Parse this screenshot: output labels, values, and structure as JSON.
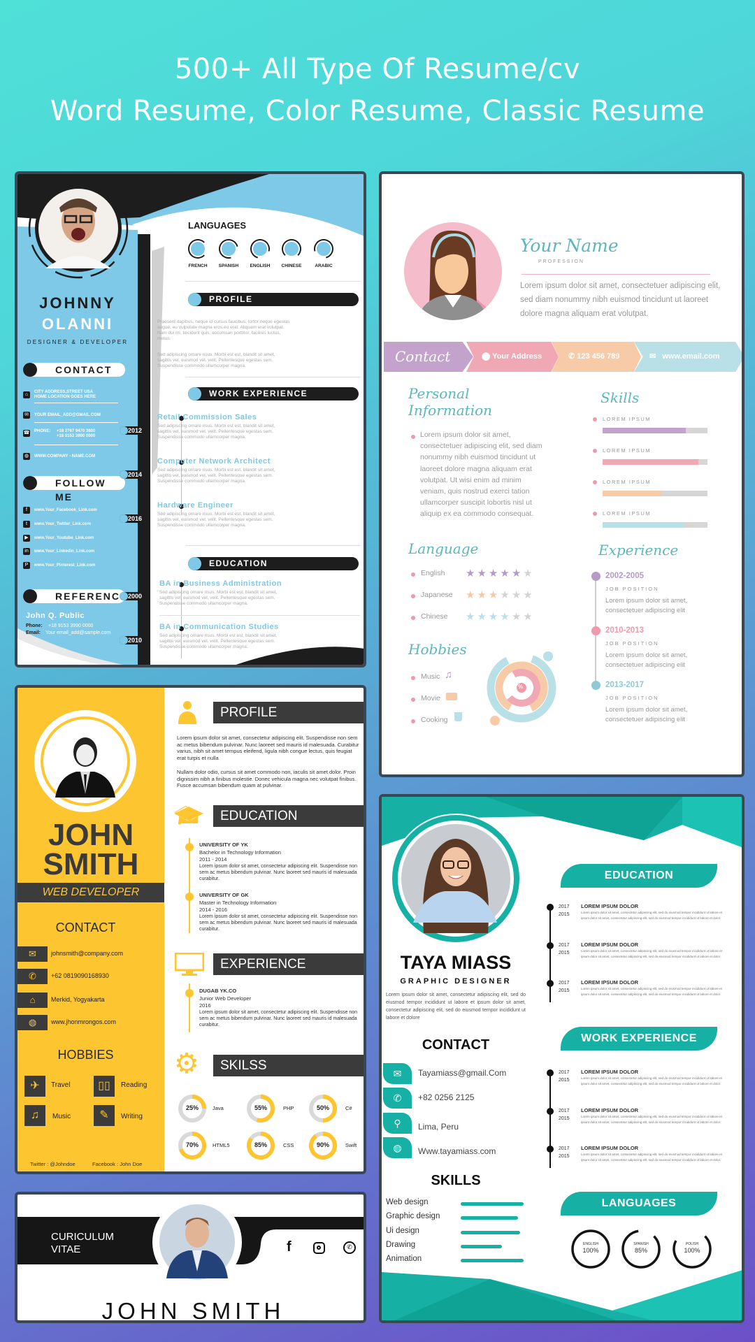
{
  "header": {
    "line1": "500+ All Type Of Resume/cv",
    "line2": "Word Resume, Color Resume, Classic Resume"
  },
  "colors": {
    "blue_template": "#7ec8e8",
    "yellow_template": "#fdc530",
    "teal_template": "#16b0a4",
    "pastel_purple": "#c3a3cc",
    "pastel_pink": "#f0a8b4",
    "pastel_peach": "#f8cba8",
    "pastel_blue": "#b8e0e6",
    "dark": "#1d1d1d"
  },
  "resume_blue": {
    "first_name": "JOHNNY",
    "last_name": "OLANNI",
    "title": "DESIGNER & DEVELOPER",
    "contact_heading": "CONTACT",
    "contact": [
      {
        "icon": "home-icon",
        "lines": [
          "CITY ADDRESS,STREET USA",
          "HOME LOCATION GOES HERE"
        ]
      },
      {
        "icon": "email-icon",
        "lines": [
          "YOUR EMAIL_ADD@GMAIL.COM"
        ]
      },
      {
        "icon": "phone-icon",
        "label": "PHONE:",
        "lines": [
          "+18 2767 9470 3800",
          "+18 9153 3990 0000"
        ]
      },
      {
        "icon": "globe-icon",
        "lines": [
          "WWW.COMPANY - NAME.COM"
        ]
      }
    ],
    "follow_heading": "FOLLOW ME",
    "social": [
      {
        "icon": "facebook-icon",
        "text": "www.Your_Facebook_Link.com"
      },
      {
        "icon": "twitter-icon",
        "text": "www.Your_Twitter_Link.com"
      },
      {
        "icon": "youtube-icon",
        "text": "www.Your_Youtube_Link.com"
      },
      {
        "icon": "linkedin-icon",
        "text": "www.Your_Linkedin_Link.com"
      },
      {
        "icon": "pinterest-icon",
        "text": "www.Your_Pinterest_Link.com"
      }
    ],
    "reference_heading": "REFERENCE",
    "reference": {
      "name": "John Q. Public",
      "phone_label": "Phone:",
      "phone": "+18 9153 3990 0000",
      "email_label": "Email:",
      "email": "Your email_add@sample.com"
    },
    "languages_heading": "LANGUAGES",
    "languages": [
      "FRENCH",
      "SPANISH",
      "ENGLISH",
      "CHINESE",
      "ARABIC"
    ],
    "profile_heading": "PROFILE",
    "profile": [
      "Praesent dapibus, neque id cursus faucibus, tortor neque egestas augue, eu vulputate magna eros eu erat. Aliquam erat volutpat. Nam dui mi, tincidunt quis, accumsan porttitor, facilisis luctus, metus.",
      "Sed adipiscing ornare risus. Morbi est est, blandit sit amet, sagittis vel, euismod vel, velit. Pellentesque egestas sem. Suspendisse commodo ullamcorper magna."
    ],
    "work_heading": "WORK EXPERIENCE",
    "work": [
      {
        "year": "2012",
        "title": "Retail Commission Sales",
        "desc": "Sed adipiscing ornare risus. Morbi est est, blandit sit amet, sagittis vel, euismod vel, velit. Pellentesque egestas sem. Suspendisse commodo ullamcorper magna."
      },
      {
        "year": "2014",
        "title": "Computer Network Architect",
        "desc": "Sed adipiscing ornare risus. Morbi est est, blandit sit amet, sagittis vel, euismod vel, velit. Pellentesque egestas sem. Suspendisse commodo ullamcorper magna."
      },
      {
        "year": "2016",
        "title": "Hardware Engineer",
        "desc": "Sed adipiscing ornare risus. Morbi est est, blandit sit amet, sagittis vel, euismod vel, velit. Pellentesque egestas sem. Suspendisse commodo ullamcorper magna."
      }
    ],
    "education_heading": "EDUCATION",
    "education": [
      {
        "year": "2000",
        "title": "BA in Business Administration",
        "desc": "Sed adipiscing ornare risus. Morbi est est, blandit sit amet, sagittis vel, euismod vel, velit. Pellentesque egestas sem. Suspendisse commodo ullamcorper magna."
      },
      {
        "year": "2010",
        "title": "BA in Communication Studies",
        "desc": "Sed adipiscing ornare risus. Morbi est est, blandit sit amet, sagittis vel, euismod vel, velit. Pellentesque egestas sem. Suspendisse commodo ullamcorper magna."
      }
    ]
  },
  "resume_pastel": {
    "name": "Your Name",
    "profession": "PROFESSION",
    "intro": "Lorem ipsum dolor sit amet, consectetuer adipiscing elit, sed diam nonummy nibh euismod tincidunt ut laoreet dolore magna aliquam erat volutpat.",
    "contact_label": "Contact",
    "address": "Your Address",
    "phone": "123 456 789",
    "email": "www.email.com",
    "personal_heading_1": "Personal",
    "personal_heading_2": "Information",
    "personal_text": "Lorem ipsum dolor sit amet, consectetuer adipiscing elit, sed diam nonummy nibh euismod tincidunt ut laoreet dolore magna aliquam erat volutpat. Ut wisi enim ad minim veniam, quis nostrud exerci tation ullamcorper suscipit lobortis nisl ut aliquip ex ea commodo consequat.",
    "skills_heading": "Skills",
    "skills": [
      {
        "label": "LOREM IPSUM",
        "level": 0.79,
        "color": "#c3a3cc"
      },
      {
        "label": "LOREM IPSUM",
        "level": 0.91,
        "color": "#f0a8b4"
      },
      {
        "label": "LOREM IPSUM",
        "level": 0.56,
        "color": "#f8cba8"
      },
      {
        "label": "LOREM IPSUM",
        "level": 0.77,
        "color": "#b8e0e6"
      }
    ],
    "language_heading": "Language",
    "languages": [
      {
        "name": "English",
        "stars": 5,
        "max": 6,
        "color": "#b59ac8"
      },
      {
        "name": "Japanese",
        "stars": 3,
        "max": 6,
        "color": "#f8c8a0"
      },
      {
        "name": "Chinese",
        "stars": 4,
        "max": 6,
        "color": "#b8e0e6"
      }
    ],
    "hobbies_heading": "Hobbies",
    "hobbies": [
      {
        "name": "Music",
        "icon": "music-note-icon"
      },
      {
        "name": "Movie",
        "icon": "camera-icon"
      },
      {
        "name": "Cooking",
        "icon": "pot-icon"
      }
    ],
    "donut_symbol": "%",
    "experience_heading": "Experience",
    "experience": [
      {
        "years": "2002-2005",
        "position": "JOB POSITION",
        "desc": "Lorem ipsum dolor sit amet, consectetuer adipiscing elit",
        "color": "#b59ac8"
      },
      {
        "years": "2010-2013",
        "position": "JOB POSITION",
        "desc": "Lorem ipsum dolor sit amet, consectetuer adipiscing elit",
        "color": "#ee9aaa"
      },
      {
        "years": "2013-2017",
        "position": "JOB POSITION",
        "desc": "Lorem ipsum dolor sit amet, consectetuer adipiscing elit",
        "color": "#8fc9d6"
      }
    ]
  },
  "resume_yellow": {
    "first_name": "JOHN",
    "last_name": "SMITH",
    "title": "WEB DEVELOPER",
    "contact_heading": "CONTACT",
    "contact": [
      {
        "icon": "email-icon",
        "text": "johnsmith@company.com"
      },
      {
        "icon": "phone-icon",
        "text": "+62 0819090168930"
      },
      {
        "icon": "home-icon",
        "text": "Merkid, Yogyakarta"
      },
      {
        "icon": "globe-icon",
        "text": "www.jhonmrongos.com"
      }
    ],
    "hobbies_heading": "HOBBIES",
    "hobbies": [
      {
        "name": "Travel",
        "icon": "airplane-icon"
      },
      {
        "name": "Reading",
        "icon": "book-icon"
      },
      {
        "name": "Music",
        "icon": "music-note-icon"
      },
      {
        "name": "Writing",
        "icon": "pencil-icon"
      }
    ],
    "footer": {
      "twitter": "Twitter : @Johndoe",
      "facebook": "Facebook : John Doe"
    },
    "profile_heading": "PROFILE",
    "profile": [
      "Lorem ipsum dolor sit amet, consectetur adipiscing elit. Suspendisse non sem ac metus bibendum pulvinar. Nunc laoreet sed mauris id malesuada. Curabitur varius, nibh sit amet tempus eleifend, ligula nibh congue lectus, quis feugiat erat turpis et nulla",
      "Nullam dolor odio, cursus sit amet commodo non, iaculis sit amet dolor. Proin dignissim nibh a finibus molestie. Donec vehicula magna nec volutpat finibus. Fusce accumsan bibendum quam at pulvinar."
    ],
    "education_heading": "EDUCATION",
    "education": [
      {
        "school": "UNIVERSITY OF YK",
        "degree": "Bachelor in Technology Information",
        "years": "2011 - 2014",
        "desc": "Lorem ipsum dolor sit amet, consectetur adipiscing elit. Suspendisse non sem ac metus bibendum pulvinar. Nunc laoreet sed mauris id malesuada curabitur."
      },
      {
        "school": "UNIVERSITY OF GK",
        "degree": "Master in Technology Information",
        "years": "2014 - 2016",
        "desc": "Lorem ipsum dolor sit amet, consectetur adipiscing elit. Suspendisse non sem ac metus bibendum pulvinar. Nunc laoreet sed mauris id malesuada curabitur."
      }
    ],
    "experience_heading": "EXPERIENCE",
    "experience": [
      {
        "company": "DUGAB YK.CO",
        "role": "Junior Web Developer",
        "year": "2016",
        "desc": "Lorem ipsum dolor sit amet, consectetur adipiscing elit. Suspendisse non sem ac metus bibendum pulvinar. Nunc laoreet sed mauris id malesuada curabitur."
      }
    ],
    "skills_heading": "SKILSS",
    "skills": [
      {
        "name": "Java",
        "percent": 25,
        "label": "25%"
      },
      {
        "name": "PHP",
        "percent": 55,
        "label": "55%"
      },
      {
        "name": "C#",
        "percent": 50,
        "label": "50%"
      },
      {
        "name": "HTML5",
        "percent": 70,
        "label": "70%"
      },
      {
        "name": "CSS",
        "percent": 85,
        "label": "85%"
      },
      {
        "name": "Swift",
        "percent": 90,
        "label": "90%"
      }
    ]
  },
  "resume_cv_strip": {
    "title_1": "CURICULUM",
    "title_2": "VITAE",
    "name": "JOHN SMITH",
    "social": [
      "facebook-icon",
      "instagram-icon",
      "whatsapp-icon"
    ]
  },
  "resume_teal": {
    "name": "TAYA MIASS",
    "title": "GRAPHIC DESIGNER",
    "about": "Lorem ipsum dolor sit amet, consectetur adipiscing elit, sed do eiusmod tempor incididunt ut labore et ipsum dolor sit amet, consectetur adipiscing elit, sed do eiusmod tempor incididunt ut labore et dolore",
    "contact_heading": "CONTACT",
    "contact": [
      {
        "icon": "email-icon",
        "text": "Tayamiass@gmail.Com"
      },
      {
        "icon": "phone-icon",
        "text": "+82 0256 2125"
      },
      {
        "icon": "location-pin-icon",
        "text": "Lima, Peru"
      },
      {
        "icon": "globe-icon",
        "text": "Www.tayamiass.com"
      }
    ],
    "skills_heading": "SKILLS",
    "skills": [
      {
        "name": "Web design",
        "level": 1.0
      },
      {
        "name": "Graphic design",
        "level": 0.91
      },
      {
        "name": "Ui design",
        "level": 0.94
      },
      {
        "name": "Drawing",
        "level": 0.65
      },
      {
        "name": "Animation",
        "level": 1.0
      }
    ],
    "education_heading": "EDUCATION",
    "education": [
      {
        "end": "2017",
        "start": "2015",
        "title": "LOREM IPSUM DOLOR",
        "desc": "Lorem ipsum dolor sit amet, consectetur adipiscing elit, sed do eiusmod tempor incididunt ut labore et ipsum dolor sit amet, consectetur adipiscing elit, sed do eiusmod tempor incididunt ut labore et dolor."
      },
      {
        "end": "2017",
        "start": "2015",
        "title": "LOREM IPSUM DOLOR",
        "desc": "Lorem ipsum dolor sit amet, consectetur adipiscing elit, sed do eiusmod tempor incididunt ut labore et ipsum dolor sit amet, consectetur adipiscing elit, sed do eiusmod tempor incididunt ut labore et dolor."
      },
      {
        "end": "2017",
        "start": "2015",
        "title": "LOREM IPSUM DOLOR",
        "desc": "Lorem ipsum dolor sit amet, consectetur adipiscing elit, sed do eiusmod tempor incididunt ut labore et ipsum dolor sit amet, consectetur adipiscing elit, sed do eiusmod tempor incididunt ut labore et dolor."
      }
    ],
    "work_heading": "WORK EXPERIENCE",
    "work": [
      {
        "end": "2017",
        "start": "2015",
        "title": "LOREM IPSUM DOLOR",
        "desc": "Lorem ipsum dolor sit amet, consectetur adipiscing elit, sed do eiusmod tempor incididunt ut labore et ipsum dolor sit amet, consectetur adipiscing elit, sed do eiusmod tempor incididunt ut labore et dolor."
      },
      {
        "end": "2017",
        "start": "2015",
        "title": "LOREM IPSUM DOLOR",
        "desc": "Lorem ipsum dolor sit amet, consectetur adipiscing elit, sed do eiusmod tempor incididunt ut labore et ipsum dolor sit amet, consectetur adipiscing elit, sed do eiusmod tempor incididunt ut labore et dolor."
      },
      {
        "end": "2017",
        "start": "2015",
        "title": "LOREM IPSUM DOLOR",
        "desc": "Lorem ipsum dolor sit amet, consectetur adipiscing elit, sed do eiusmod tempor incididunt ut labore et ipsum dolor sit amet, consectetur adipiscing elit, sed do eiusmod tempor incididunt ut labore et dolor."
      }
    ],
    "languages_heading": "LANGUAGES",
    "languages": [
      {
        "name": "ENGLISH",
        "label": "100%",
        "level": 1.0
      },
      {
        "name": "SPANISH",
        "label": "85%",
        "level": 0.85
      },
      {
        "name": "POLISH",
        "label": "100%",
        "level": 0.7
      }
    ]
  }
}
